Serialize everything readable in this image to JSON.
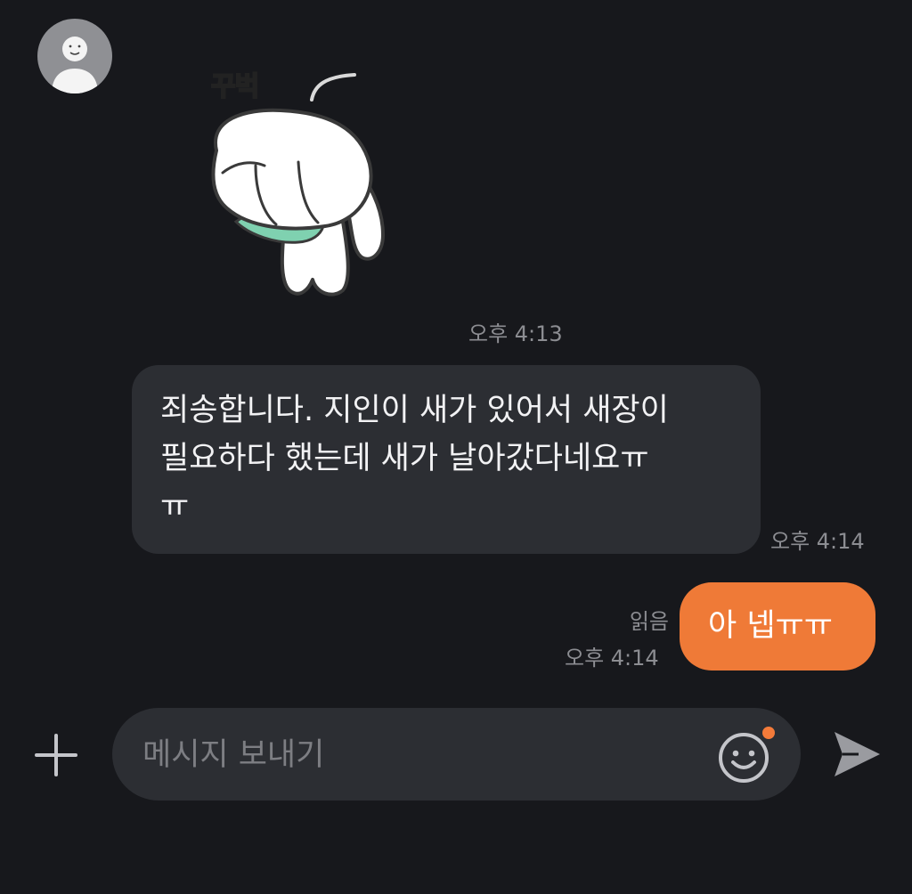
{
  "sticker": {
    "caption": "꾸벅"
  },
  "messages": [
    {
      "direction": "incoming",
      "kind": "sticker",
      "time": "오후 4:13"
    },
    {
      "direction": "incoming",
      "kind": "text",
      "lines": [
        "죄송합니다. 지인이 새가 있어서 새장이",
        "필요하다 했는데 새가 날아갔다네요ㅠ",
        "ㅠ"
      ],
      "time": "오후 4:14"
    },
    {
      "direction": "outgoing",
      "kind": "text",
      "text": "아 넵ㅠㅠ",
      "read_status": "읽음",
      "time": "오후 4:14"
    }
  ],
  "composer": {
    "placeholder": "메시지 보내기",
    "value": ""
  },
  "icons": {
    "avatar": "default-person-avatar",
    "attach": "plus-icon",
    "emoji": "smiley-icon",
    "send": "send-arrow-icon"
  },
  "colors": {
    "background": "#17181c",
    "incoming_bubble": "#2c2e33",
    "outgoing_bubble": "#ef7a37",
    "notification_dot": "#f47b3a"
  }
}
